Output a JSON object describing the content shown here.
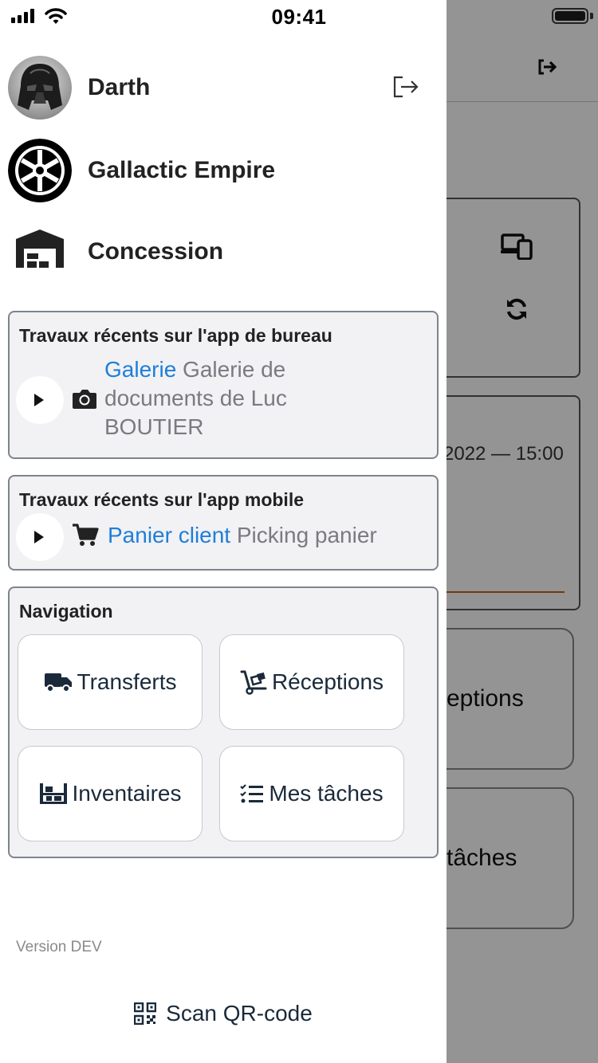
{
  "status_bar": {
    "time": "09:41"
  },
  "background": {
    "date_text": "2022 — 15:00",
    "button1_label": "eptions",
    "button2_label": "tâches"
  },
  "drawer": {
    "user": {
      "name": "Darth",
      "avatar_icon": "darth-vader-avatar"
    },
    "company": {
      "name": "Gallactic Empire",
      "logo_icon": "imperial-crest-logo"
    },
    "location": {
      "name": "Concession",
      "icon": "warehouse-icon"
    },
    "recent_desktop": {
      "title": "Travaux récents sur l'app de bureau",
      "item": {
        "link": "Galerie",
        "description": " Galerie de documents de Luc BOUTIER",
        "icon": "camera-icon"
      }
    },
    "recent_mobile": {
      "title": "Travaux récents sur l'app mobile",
      "item": {
        "link": "Panier client",
        "description": " Picking panier",
        "icon": "cart-icon"
      }
    },
    "navigation": {
      "title": "Navigation",
      "buttons": [
        {
          "label": "Transferts",
          "icon": "truck-icon"
        },
        {
          "label": "Réceptions",
          "icon": "dolly-icon"
        },
        {
          "label": "Inventaires",
          "icon": "shelves-icon"
        },
        {
          "label": "Mes tâches",
          "icon": "task-list-icon"
        }
      ]
    },
    "version": "Version DEV",
    "scan_label": "Scan QR-code"
  },
  "colors": {
    "link": "#1d7fd8",
    "card_bg": "#f2f1f4",
    "card_border": "#7d858c",
    "overlay": "rgba(0,0,0,0.42)",
    "accent_line": "#c0651e"
  }
}
